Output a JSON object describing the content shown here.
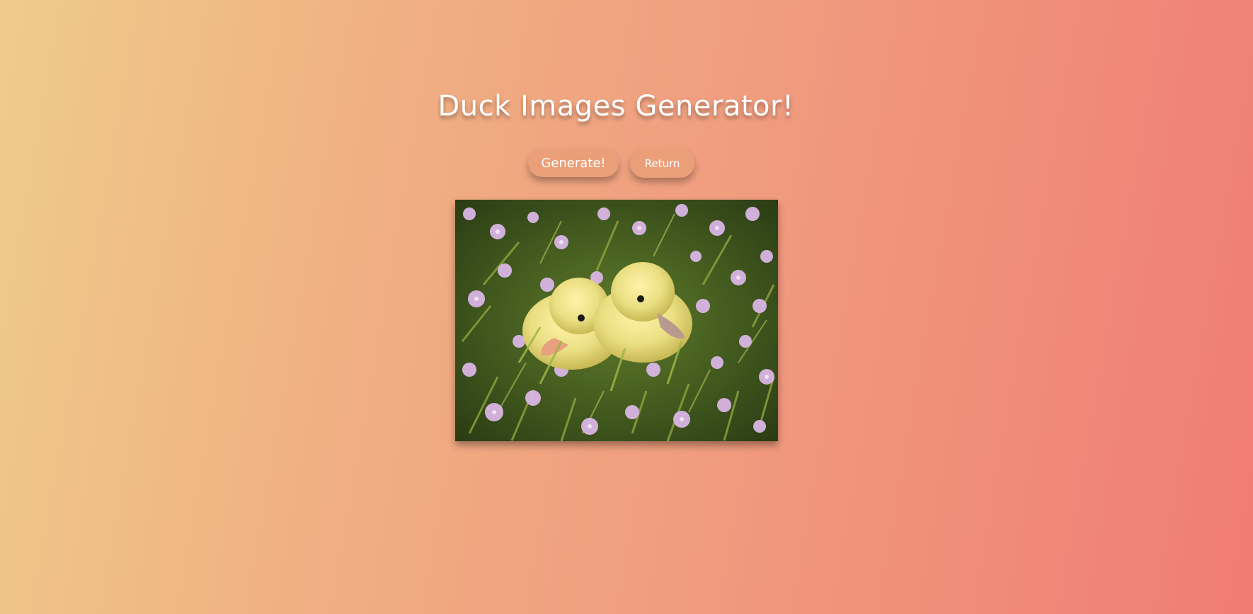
{
  "page": {
    "title": "Duck Images Generator!"
  },
  "buttons": {
    "generate_label": "Generate!",
    "return_label": "Return"
  },
  "image": {
    "subject": "two yellow ducklings among purple flowers"
  },
  "colors": {
    "gradient_start": "#efcb8b",
    "gradient_end": "#f07c74",
    "button_bg": "#eb9f79",
    "text": "#ffffff"
  }
}
